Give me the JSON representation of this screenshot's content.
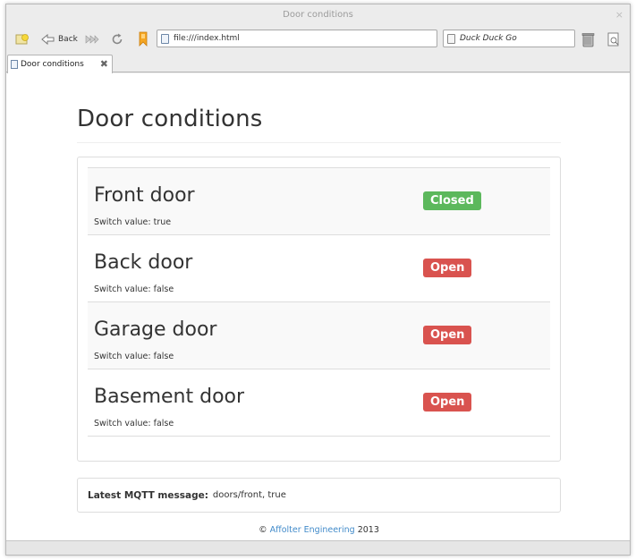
{
  "window": {
    "title": "Door conditions",
    "close_glyph": "×"
  },
  "toolbar": {
    "back_label": "Back",
    "url": "file:///index.html",
    "search_placeholder": "Duck Duck Go",
    "icons": [
      "new-window-icon",
      "back-arrow-icon",
      "forward-icon",
      "reload-icon",
      "bookmark-icon",
      "trash-icon",
      "print-preview-icon"
    ]
  },
  "tabs": [
    {
      "label": "Door conditions",
      "close_glyph": "✖"
    }
  ],
  "page": {
    "title": "Door conditions",
    "switch_prefix": "Switch value:",
    "doors": [
      {
        "name": "Front door",
        "switch_value": "true",
        "status": "Closed"
      },
      {
        "name": "Back door",
        "switch_value": "false",
        "status": "Open"
      },
      {
        "name": "Garage door",
        "switch_value": "false",
        "status": "Open"
      },
      {
        "name": "Basement door",
        "switch_value": "false",
        "status": "Open"
      }
    ],
    "mqtt": {
      "label": "Latest MQTT message:",
      "message": "doors/front, true"
    },
    "footer": {
      "copyright": "©",
      "company": "Affolter Engineering",
      "year": "2013"
    }
  },
  "colors": {
    "closed_badge": "#5cb85c",
    "open_badge": "#d9534f",
    "link": "#428bca"
  }
}
